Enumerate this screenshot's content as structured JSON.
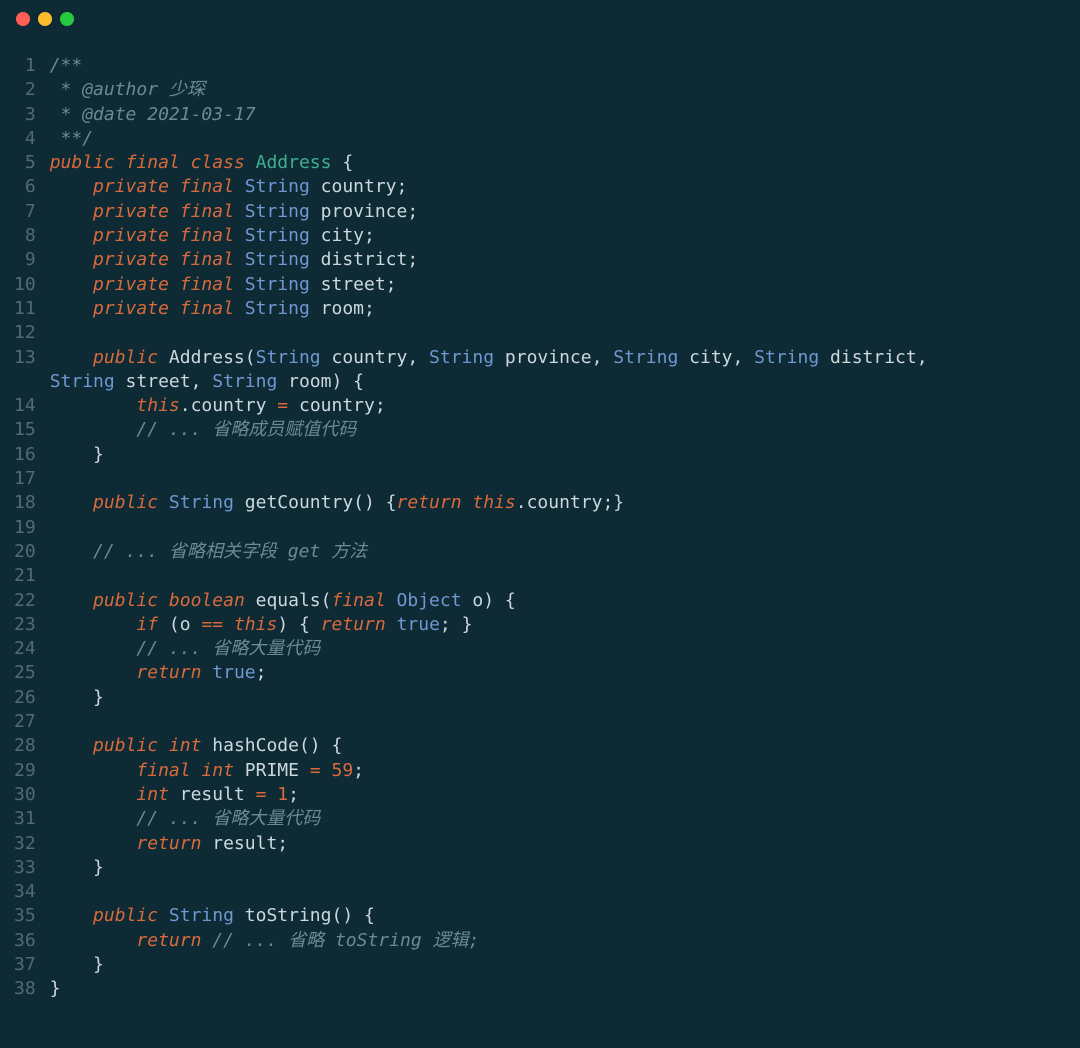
{
  "colors": {
    "bg": "#0d2a35",
    "gutter": "#516b76",
    "text": "#cdd8dd",
    "comment": "#6b8a95",
    "keyword": "#d96a3b",
    "type": "#6f98d1",
    "classname": "#3fae8f",
    "dot_red": "#ff5f56",
    "dot_yellow": "#ffbd2e",
    "dot_green": "#27c93f"
  },
  "line_numbers": [
    "1",
    "2",
    "3",
    "4",
    "5",
    "6",
    "7",
    "8",
    "9",
    "10",
    "11",
    "12",
    "13",
    "",
    "14",
    "15",
    "16",
    "17",
    "18",
    "19",
    "20",
    "21",
    "22",
    "23",
    "24",
    "25",
    "26",
    "27",
    "28",
    "29",
    "30",
    "31",
    "32",
    "33",
    "34",
    "35",
    "36",
    "37",
    "38"
  ],
  "code": [
    [
      [
        "comment",
        "/**"
      ]
    ],
    [
      [
        "comment",
        " * @author 少琛"
      ]
    ],
    [
      [
        "comment",
        " * @date 2021-03-17"
      ]
    ],
    [
      [
        "comment",
        " **/"
      ]
    ],
    [
      [
        "kw",
        "public"
      ],
      [
        "p",
        " "
      ],
      [
        "kw",
        "final"
      ],
      [
        "p",
        " "
      ],
      [
        "kw",
        "class"
      ],
      [
        "p",
        " "
      ],
      [
        "class",
        "Address"
      ],
      [
        "p",
        " {"
      ]
    ],
    [
      [
        "p",
        "    "
      ],
      [
        "kw",
        "private"
      ],
      [
        "p",
        " "
      ],
      [
        "kw",
        "final"
      ],
      [
        "p",
        " "
      ],
      [
        "type",
        "String"
      ],
      [
        "p",
        " country;"
      ]
    ],
    [
      [
        "p",
        "    "
      ],
      [
        "kw",
        "private"
      ],
      [
        "p",
        " "
      ],
      [
        "kw",
        "final"
      ],
      [
        "p",
        " "
      ],
      [
        "type",
        "String"
      ],
      [
        "p",
        " province;"
      ]
    ],
    [
      [
        "p",
        "    "
      ],
      [
        "kw",
        "private"
      ],
      [
        "p",
        " "
      ],
      [
        "kw",
        "final"
      ],
      [
        "p",
        " "
      ],
      [
        "type",
        "String"
      ],
      [
        "p",
        " city;"
      ]
    ],
    [
      [
        "p",
        "    "
      ],
      [
        "kw",
        "private"
      ],
      [
        "p",
        " "
      ],
      [
        "kw",
        "final"
      ],
      [
        "p",
        " "
      ],
      [
        "type",
        "String"
      ],
      [
        "p",
        " district;"
      ]
    ],
    [
      [
        "p",
        "    "
      ],
      [
        "kw",
        "private"
      ],
      [
        "p",
        " "
      ],
      [
        "kw",
        "final"
      ],
      [
        "p",
        " "
      ],
      [
        "type",
        "String"
      ],
      [
        "p",
        " street;"
      ]
    ],
    [
      [
        "p",
        "    "
      ],
      [
        "kw",
        "private"
      ],
      [
        "p",
        " "
      ],
      [
        "kw",
        "final"
      ],
      [
        "p",
        " "
      ],
      [
        "type",
        "String"
      ],
      [
        "p",
        " room;"
      ]
    ],
    [
      [
        "p",
        ""
      ]
    ],
    [
      [
        "p",
        "    "
      ],
      [
        "kw",
        "public"
      ],
      [
        "p",
        " Address("
      ],
      [
        "type",
        "String"
      ],
      [
        "p",
        " country, "
      ],
      [
        "type",
        "String"
      ],
      [
        "p",
        " province, "
      ],
      [
        "type",
        "String"
      ],
      [
        "p",
        " city, "
      ],
      [
        "type",
        "String"
      ],
      [
        "p",
        " district, "
      ],
      [
        "type",
        "String"
      ],
      [
        "p",
        " street, "
      ],
      [
        "type",
        "String"
      ],
      [
        "p",
        " room) {"
      ]
    ],
    [
      [
        "p",
        ""
      ]
    ],
    [
      [
        "p",
        "        "
      ],
      [
        "kw",
        "this"
      ],
      [
        "p",
        ".country "
      ],
      [
        "eq",
        "="
      ],
      [
        "p",
        " country;"
      ]
    ],
    [
      [
        "p",
        "        "
      ],
      [
        "comment",
        "// ... 省略成员赋值代码"
      ]
    ],
    [
      [
        "p",
        "    }"
      ]
    ],
    [
      [
        "p",
        ""
      ]
    ],
    [
      [
        "p",
        "    "
      ],
      [
        "kw",
        "public"
      ],
      [
        "p",
        " "
      ],
      [
        "type",
        "String"
      ],
      [
        "p",
        " getCountry() {"
      ],
      [
        "kw",
        "return"
      ],
      [
        "p",
        " "
      ],
      [
        "kw",
        "this"
      ],
      [
        "p",
        ".country;}"
      ]
    ],
    [
      [
        "p",
        ""
      ]
    ],
    [
      [
        "p",
        "    "
      ],
      [
        "comment",
        "// ... 省略相关字段 get 方法"
      ]
    ],
    [
      [
        "p",
        ""
      ]
    ],
    [
      [
        "p",
        "    "
      ],
      [
        "kw",
        "public"
      ],
      [
        "p",
        " "
      ],
      [
        "kw",
        "boolean"
      ],
      [
        "p",
        " equals("
      ],
      [
        "kw",
        "final"
      ],
      [
        "p",
        " "
      ],
      [
        "type",
        "Object"
      ],
      [
        "p",
        " o) {"
      ]
    ],
    [
      [
        "p",
        "        "
      ],
      [
        "kw",
        "if"
      ],
      [
        "p",
        " (o "
      ],
      [
        "eq",
        "=="
      ],
      [
        "p",
        " "
      ],
      [
        "kw",
        "this"
      ],
      [
        "p",
        ") { "
      ],
      [
        "kw",
        "return"
      ],
      [
        "p",
        " "
      ],
      [
        "bool",
        "true"
      ],
      [
        "p",
        "; }"
      ]
    ],
    [
      [
        "p",
        "        "
      ],
      [
        "comment",
        "// ... 省略大量代码"
      ]
    ],
    [
      [
        "p",
        "        "
      ],
      [
        "kw",
        "return"
      ],
      [
        "p",
        " "
      ],
      [
        "bool",
        "true"
      ],
      [
        "p",
        ";"
      ]
    ],
    [
      [
        "p",
        "    }"
      ]
    ],
    [
      [
        "p",
        ""
      ]
    ],
    [
      [
        "p",
        "    "
      ],
      [
        "kw",
        "public"
      ],
      [
        "p",
        " "
      ],
      [
        "kw",
        "int"
      ],
      [
        "p",
        " hashCode() {"
      ]
    ],
    [
      [
        "p",
        "        "
      ],
      [
        "kw",
        "final"
      ],
      [
        "p",
        " "
      ],
      [
        "kw",
        "int"
      ],
      [
        "p",
        " PRIME "
      ],
      [
        "eq",
        "="
      ],
      [
        "p",
        " "
      ],
      [
        "num",
        "59"
      ],
      [
        "p",
        ";"
      ]
    ],
    [
      [
        "p",
        "        "
      ],
      [
        "kw",
        "int"
      ],
      [
        "p",
        " result "
      ],
      [
        "eq",
        "="
      ],
      [
        "p",
        " "
      ],
      [
        "num",
        "1"
      ],
      [
        "p",
        ";"
      ]
    ],
    [
      [
        "p",
        "        "
      ],
      [
        "comment",
        "// ... 省略大量代码"
      ]
    ],
    [
      [
        "p",
        "        "
      ],
      [
        "kw",
        "return"
      ],
      [
        "p",
        " result;"
      ]
    ],
    [
      [
        "p",
        "    }"
      ]
    ],
    [
      [
        "p",
        ""
      ]
    ],
    [
      [
        "p",
        "    "
      ],
      [
        "kw",
        "public"
      ],
      [
        "p",
        " "
      ],
      [
        "type",
        "String"
      ],
      [
        "p",
        " toString() {"
      ]
    ],
    [
      [
        "p",
        "        "
      ],
      [
        "kw",
        "return"
      ],
      [
        "p",
        " "
      ],
      [
        "comment",
        "// ... 省略 toString 逻辑;"
      ]
    ],
    [
      [
        "p",
        "    }"
      ]
    ],
    [
      [
        "p",
        "}"
      ]
    ]
  ]
}
